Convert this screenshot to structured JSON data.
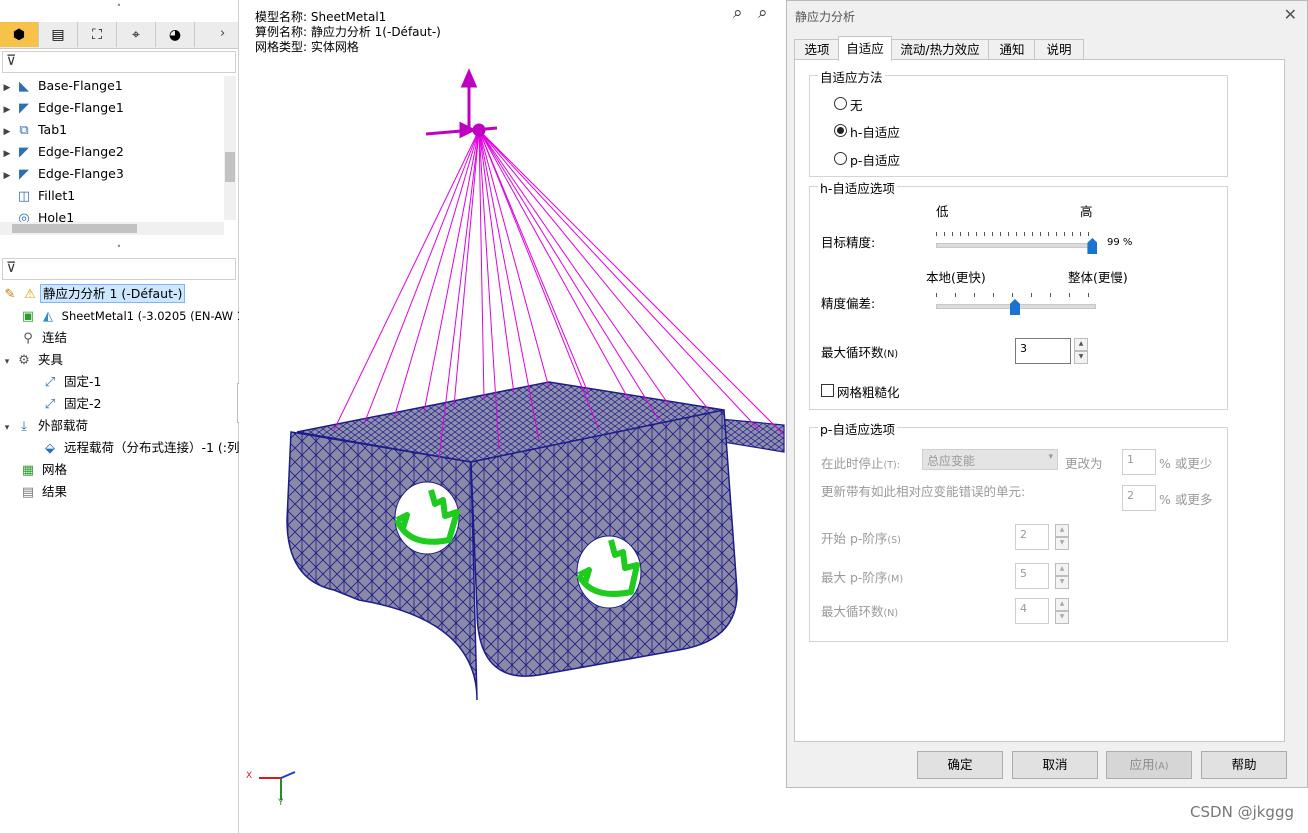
{
  "left_panel": {
    "tabs": [
      {
        "icon": "feature-manager-icon",
        "glyph": "⬢"
      },
      {
        "icon": "property-manager-icon",
        "glyph": "▤"
      },
      {
        "icon": "configuration-manager-icon",
        "glyph": "⛶"
      },
      {
        "icon": "dimxpert-icon",
        "glyph": "⌖"
      },
      {
        "icon": "display-manager-icon",
        "glyph": "◕"
      }
    ],
    "feature_tree": [
      {
        "label": "Base-Flange1"
      },
      {
        "label": "Edge-Flange1"
      },
      {
        "label": "Tab1"
      },
      {
        "label": "Edge-Flange2"
      },
      {
        "label": "Edge-Flange3"
      },
      {
        "label": "Fillet1"
      },
      {
        "label": "Hole1"
      }
    ],
    "sim_tree": {
      "study": "静应力分析 1 (-Défaut-)",
      "part": "SheetMetal1 (-3.0205 (EN-AW 12",
      "connections": "连结",
      "fixtures": "夹具",
      "fixture_items": [
        "固定-1",
        "固定-2"
      ],
      "external_loads": "外部载荷",
      "load_items": [
        "远程载荷（分布式连接）-1 (:列"
      ],
      "mesh": "网格",
      "results": "结果"
    }
  },
  "viewport": {
    "model_name": "模型名称: SheetMetal1",
    "study_name": "算例名称: 静应力分析 1(-Défaut-)",
    "mesh_type": "网格类型: 实体网格",
    "triad_x": "X",
    "triad_y": "Y",
    "colors": {
      "mesh_fill": "#8a8aa6",
      "mesh_line": "#1c1c8c",
      "load": "#e000e0",
      "fixture": "#1ecb1e"
    }
  },
  "dialog": {
    "title": "静应力分析",
    "tabs": [
      "选项",
      "自适应",
      "流动/热力效应",
      "通知",
      "说明"
    ],
    "active_tab": "自适应",
    "adaptive_method": {
      "title": "自适应方法",
      "options": [
        "无",
        "h-自适应",
        "p-自适应"
      ],
      "selected": "h-自适应"
    },
    "h_options": {
      "title": "h-自适应选项",
      "accuracy_low": "低",
      "accuracy_high": "高",
      "target_accuracy_label": "目标精度:",
      "target_accuracy_value": "99 %",
      "target_accuracy_level": 0.99,
      "local_label": "本地(更快)",
      "global_label": "整体(更慢)",
      "accuracy_bias_label": "精度偏差:",
      "accuracy_bias_level": 0.5,
      "max_loops_label": "最大循环数",
      "max_loops_shortcut": "(N)",
      "max_loops_value": "3",
      "coarsen_label": "网格粗糙化"
    },
    "p_options": {
      "title": "p-自适应选项",
      "stop_when_label": "在此时停止",
      "stop_when_shortcut": "(T):",
      "stop_when_value": "总应变能",
      "change_by_label": "更改为",
      "change_value": "1",
      "or_less": "% 或更少",
      "update_elements_label": "更新带有如此相对应变能错误的单元:",
      "update_value": "2",
      "or_more": "% 或更多",
      "start_order_label": "开始 p-阶序",
      "start_order_shortcut": "(S)",
      "start_order_value": "2",
      "max_order_label": "最大 p-阶序",
      "max_order_shortcut": "(M)",
      "max_order_value": "5",
      "max_loops_label": "最大循环数",
      "max_loops_shortcut": "(N)",
      "max_loops_value": "4"
    },
    "buttons": {
      "ok": "确定",
      "cancel": "取消",
      "apply": "应用",
      "apply_shortcut": "(A)",
      "help": "帮助"
    }
  },
  "watermark": "CSDN @jkggg"
}
